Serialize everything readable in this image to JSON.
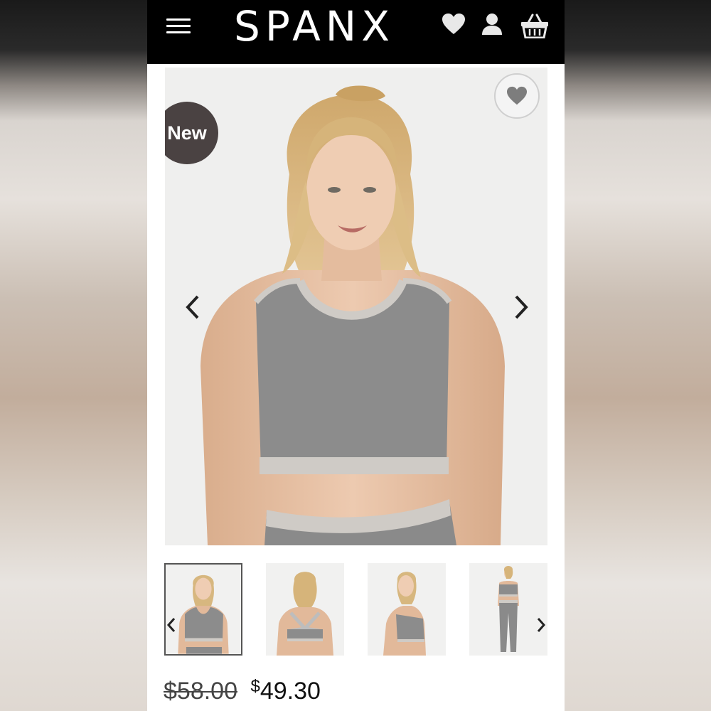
{
  "header": {
    "brand": "SPANX",
    "icons": [
      "menu-icon",
      "heart-icon",
      "user-icon",
      "basket-icon"
    ]
  },
  "product": {
    "badge": "New",
    "gallery_icons": [
      "wishlist-heart-icon",
      "chevron-left-icon",
      "chevron-right-icon"
    ],
    "thumbnails": [
      "front",
      "back",
      "side",
      "full-body"
    ],
    "active_thumbnail": 0
  },
  "pricing": {
    "original_price": "$58.00",
    "sale_currency": "$",
    "sale_price": "49.30"
  },
  "colors": {
    "header_bg": "#000000",
    "badge_bg": "#4a4242",
    "product_gray": "#8a8a8a",
    "trim_gray": "#cfcbc6",
    "skin": "#e8c3a6",
    "hair": "#d9b77e"
  }
}
